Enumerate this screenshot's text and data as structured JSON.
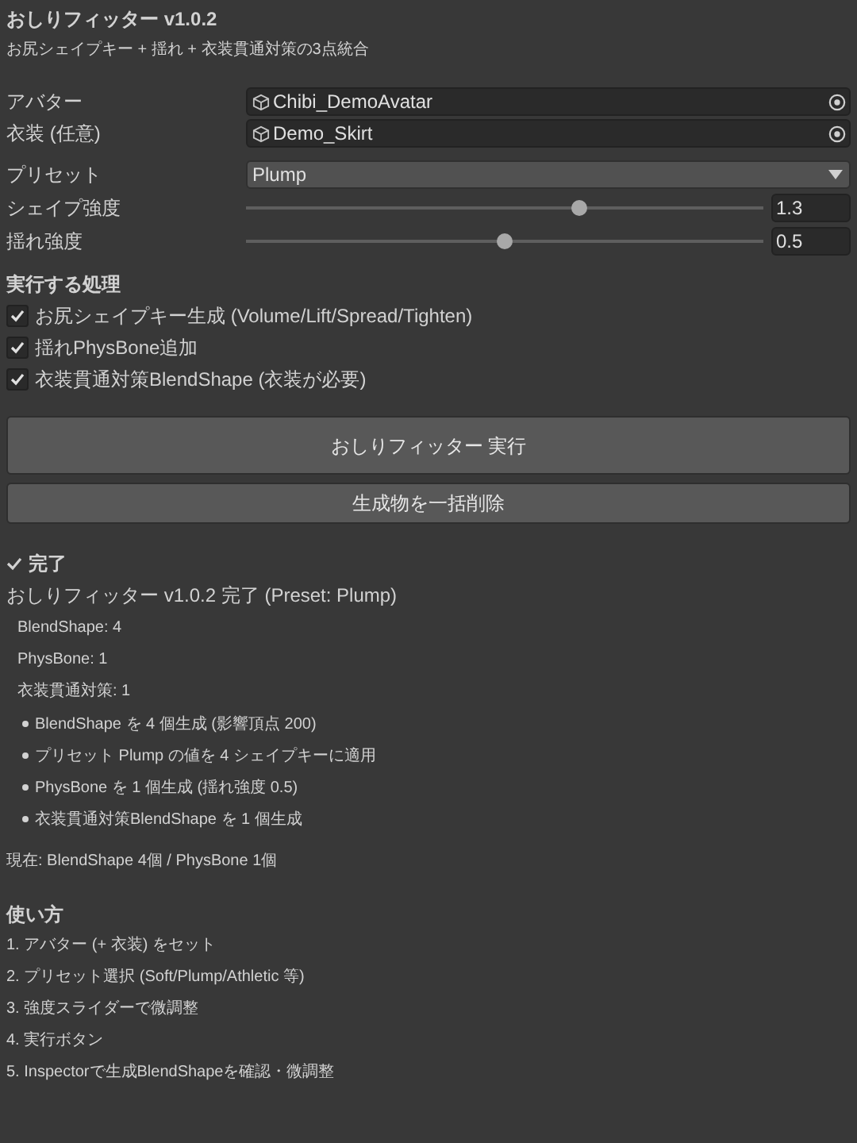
{
  "title": "おしりフィッター v1.0.2",
  "subtitle": "お尻シェイプキー + 揺れ + 衣装貫通対策の3点統合",
  "object_fields": [
    {
      "label": "アバター",
      "value": "Chibi_DemoAvatar"
    },
    {
      "label": "衣装 (任意)",
      "value": "Demo_Skirt"
    }
  ],
  "preset": {
    "label": "プリセット",
    "value": "Plump"
  },
  "sliders": [
    {
      "label": "シェイプ強度",
      "level": 0.645,
      "reading": "1.3"
    },
    {
      "label": "揺れ強度",
      "level": 0.5,
      "reading": "0.5"
    }
  ],
  "tasks": {
    "heading": "実行する処理",
    "items": [
      {
        "label": "お尻シェイプキー生成 (Volume/Lift/Spread/Tighten)",
        "checked": true
      },
      {
        "label": "揺れPhysBone追加",
        "checked": true
      },
      {
        "label": "衣装貫通対策BlendShape (衣装が必要)",
        "checked": true
      }
    ]
  },
  "buttons": [
    {
      "label": "おしりフィッター 実行",
      "kind": "primary"
    },
    {
      "label": "生成物を一括削除",
      "kind": "secondary"
    }
  ],
  "result": {
    "heading": "完了",
    "summary": "おしりフィッター v1.0.2 完了 (Preset: Plump)",
    "counts": [
      "BlendShape: 4",
      "PhysBone: 1",
      "衣装貫通対策: 1"
    ],
    "bullets": [
      "BlendShape を 4 個生成 (影響頂点 200)",
      "プリセット Plump の値を 4 シェイプキーに適用",
      "PhysBone を 1 個生成 (揺れ強度 0.5)",
      "衣装貫通対策BlendShape を 1 個生成"
    ],
    "current": "現在: BlendShape 4個 / PhysBone 1個"
  },
  "usage": {
    "heading": "使い方",
    "steps": [
      "1. アバター (+ 衣装) をセット",
      "2. プリセット選択 (Soft/Plump/Athletic 等)",
      "3. 強度スライダーで微調整",
      "4. 実行ボタン",
      "5. Inspectorで生成BlendShapeを確認・微調整"
    ]
  }
}
